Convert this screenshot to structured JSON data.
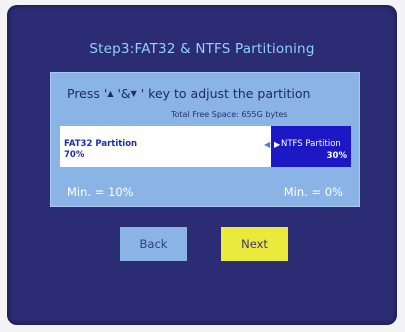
{
  "title": "Step3:FAT32 & NTFS Partitioning",
  "instruction": {
    "prefix": "Press '",
    "key_up": "▲",
    "middle": " '&",
    "key_down": "▼",
    "suffix": " ' key to adjust the partition"
  },
  "free_space": "Total Free Space: 655G bytes",
  "partition": {
    "fat32": {
      "label": "FAT32 Partition",
      "percent_text": "70%",
      "percent": 70
    },
    "ntfs": {
      "label": "NTFS Partition",
      "percent_text": "30%",
      "percent": 30
    },
    "left_arrow": "◀",
    "right_arrow": "▶"
  },
  "limits": {
    "fat32_min": "Min. = 10%",
    "ntfs_min": "Min. = 0%"
  },
  "buttons": {
    "back": "Back",
    "next": "Next"
  },
  "colors": {
    "background": "#2b2c74",
    "title": "#8fd3f6",
    "panel": "#8ab3e6",
    "ntfs_fill": "#1c18c6",
    "next_button": "#eaea3c"
  }
}
